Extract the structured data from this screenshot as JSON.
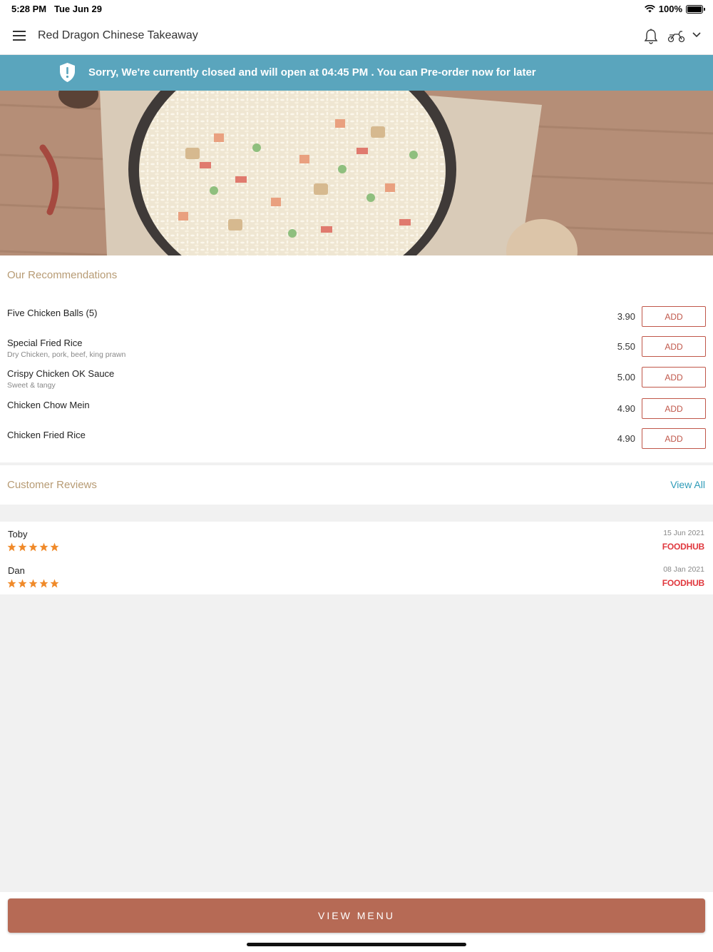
{
  "status_bar": {
    "time": "5:28 PM",
    "date": "Tue Jun 29",
    "battery": "100%"
  },
  "header": {
    "title": "Red Dragon Chinese Takeaway",
    "icons": [
      "menu-icon",
      "bell-icon",
      "delivery-scooter-icon",
      "chevron-down-icon"
    ]
  },
  "banner": {
    "text": "Sorry, We're currently closed and will open at 04:45 PM . You can Pre-order now for later",
    "color": "#5aa5bd"
  },
  "recommendations": {
    "title": "Our Recommendations",
    "add_label": "ADD",
    "items": [
      {
        "name": "Five Chicken Balls (5)",
        "desc": "",
        "price": "3.90"
      },
      {
        "name": "Special Fried Rice",
        "desc": "Dry  Chicken, pork, beef, king prawn",
        "price": "5.50"
      },
      {
        "name": "Crispy Chicken OK Sauce",
        "desc": "Sweet & tangy",
        "price": "5.00"
      },
      {
        "name": "Chicken Chow Mein",
        "desc": "",
        "price": "4.90"
      },
      {
        "name": "Chicken Fried Rice",
        "desc": "",
        "price": "4.90"
      }
    ]
  },
  "reviews": {
    "title": "Customer Reviews",
    "view_all": "View All",
    "items": [
      {
        "name": "Toby",
        "date": "15 Jun 2021",
        "rating": 5,
        "source": "FOODHUB"
      },
      {
        "name": "Dan",
        "date": "08 Jan 2021",
        "rating": 5,
        "source": "FOODHUB"
      }
    ]
  },
  "footer": {
    "button": "VIEW MENU",
    "color": "#b66a55"
  }
}
